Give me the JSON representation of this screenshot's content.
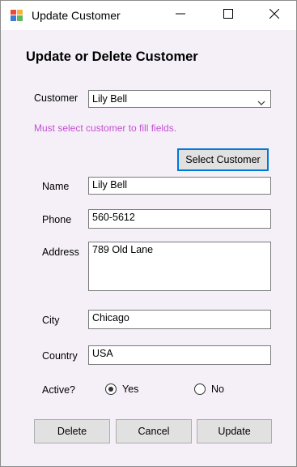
{
  "window": {
    "title": "Update Customer"
  },
  "form": {
    "heading": "Update or Delete Customer",
    "customer_label": "Customer",
    "customer_value": "Lily Bell",
    "hint": "Must select customer to fill fields.",
    "select_button": "Select Customer",
    "name_label": "Name",
    "name_value": "Lily Bell",
    "phone_label": "Phone",
    "phone_value": "560-5612",
    "address_label": "Address",
    "address_value": "789 Old Lane",
    "city_label": "City",
    "city_value": "Chicago",
    "country_label": "Country",
    "country_value": "USA",
    "active_label": "Active?",
    "active_yes": "Yes",
    "active_no": "No",
    "active_selected": "Yes"
  },
  "buttons": {
    "delete": "Delete",
    "cancel": "Cancel",
    "update": "Update"
  },
  "icons": {
    "app": "form-app-icon",
    "minimize": "minimize-icon",
    "maximize": "maximize-icon",
    "close": "close-icon",
    "dropdown": "chevron-down-icon"
  },
  "colors": {
    "hint": "#c44fd1",
    "focus_border": "#0078d7",
    "window_bg": "#f5f0f8"
  }
}
